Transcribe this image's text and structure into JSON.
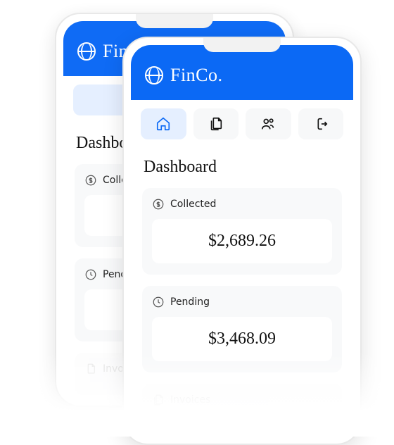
{
  "brand": "FinCo.",
  "nav": {
    "home": "home",
    "docs": "documents",
    "people": "people",
    "exit": "exit"
  },
  "page": {
    "title": "Dashboard"
  },
  "cards": {
    "collected": {
      "label": "Collected",
      "amount": "$2,689.26"
    },
    "pending": {
      "label": "Pending",
      "amount": "$3,468.09"
    },
    "invoices": {
      "label": "Invoices"
    }
  }
}
